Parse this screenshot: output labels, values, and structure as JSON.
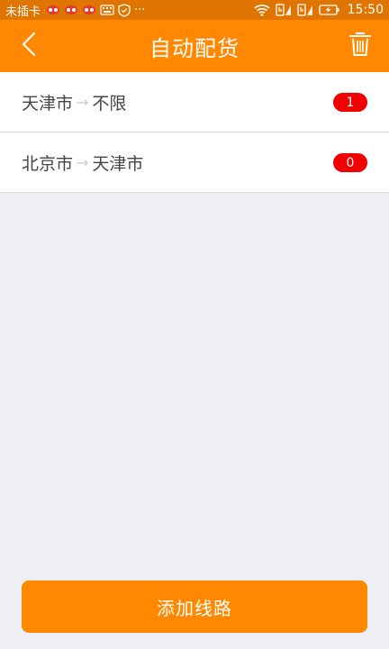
{
  "status_bar": {
    "carrier": "未插卡",
    "more": "···",
    "time": "15:50"
  },
  "nav": {
    "title": "自动配货",
    "back_icon": "chevron-left-icon",
    "trash_icon": "trash-icon"
  },
  "routes": [
    {
      "from": "天津市",
      "arrow": "→",
      "to": "不限",
      "count": "1"
    },
    {
      "from": "北京市",
      "arrow": "→",
      "to": "天津市",
      "count": "0"
    }
  ],
  "footer": {
    "add_label": "添加线路"
  },
  "colors": {
    "status_bar": "#e07400",
    "nav_bar": "#ff8800",
    "badge": "#f00000",
    "background": "#efeef3",
    "button": "#ff8800"
  }
}
